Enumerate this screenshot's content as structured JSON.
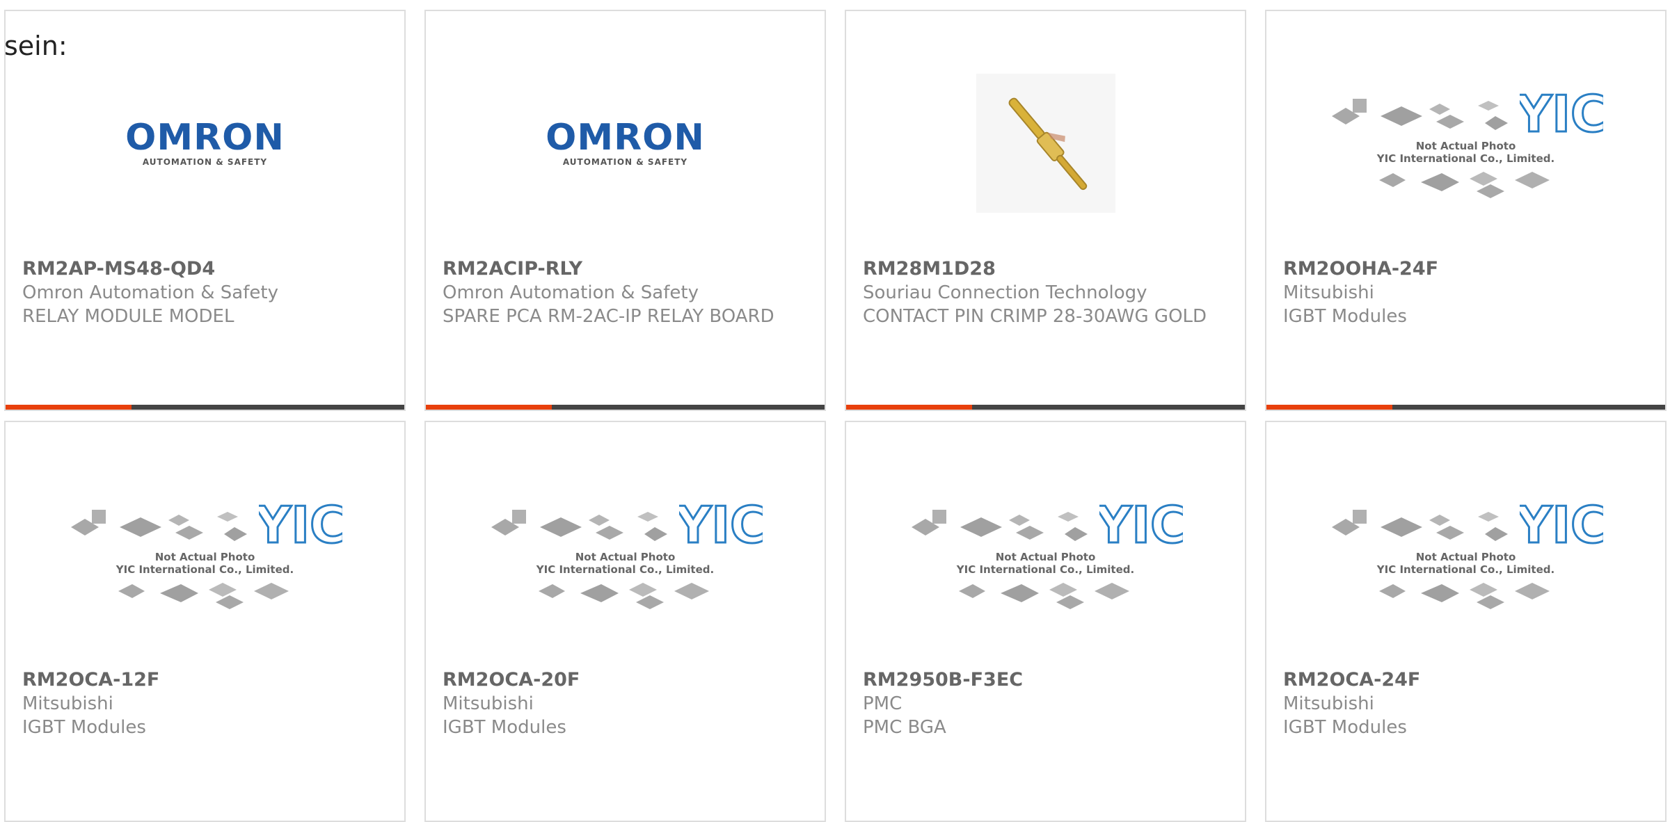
{
  "intro_text": "sein:",
  "cards": [
    {
      "part_number": "RM2AP-MS48-QD4",
      "manufacturer": "Omron Automation & Safety",
      "description": "RELAY MODULE MODEL",
      "image": "omron-logo"
    },
    {
      "part_number": "RM2ACIP-RLY",
      "manufacturer": "Omron Automation & Safety",
      "description": "SPARE PCA RM-2AC-IP RELAY BOARD",
      "image": "omron-logo"
    },
    {
      "part_number": "RM28M1D28",
      "manufacturer": "Souriau Connection Technology",
      "description": "CONTACT PIN CRIMP 28-30AWG GOLD",
      "image": "contact-pin-photo"
    },
    {
      "part_number": "RM2OOHA-24F",
      "manufacturer": "Mitsubishi",
      "description": "IGBT Modules",
      "image": "yic-placeholder"
    },
    {
      "part_number": "RM2OCA-12F",
      "manufacturer": "Mitsubishi",
      "description": "IGBT Modules",
      "image": "yic-placeholder"
    },
    {
      "part_number": "RM2OCA-20F",
      "manufacturer": "Mitsubishi",
      "description": "IGBT Modules",
      "image": "yic-placeholder"
    },
    {
      "part_number": "RM2950B-F3EC",
      "manufacturer": "PMC",
      "description": "PMC BGA",
      "image": "yic-placeholder"
    },
    {
      "part_number": "RM2OCA-24F",
      "manufacturer": "Mitsubishi",
      "description": "IGBT Modules",
      "image": "yic-placeholder"
    }
  ],
  "logos": {
    "omron": {
      "word": "OMRON",
      "tagline": "AUTOMATION & SAFETY"
    },
    "yic": {
      "monogram": "YIC",
      "line1": "Not Actual Photo",
      "line2": "YIC International Co., Limited."
    }
  },
  "colors": {
    "accent": "#e8400c",
    "bar": "#444444",
    "omron_blue": "#1f5ba8",
    "yic_blue": "#2a7fc4"
  }
}
